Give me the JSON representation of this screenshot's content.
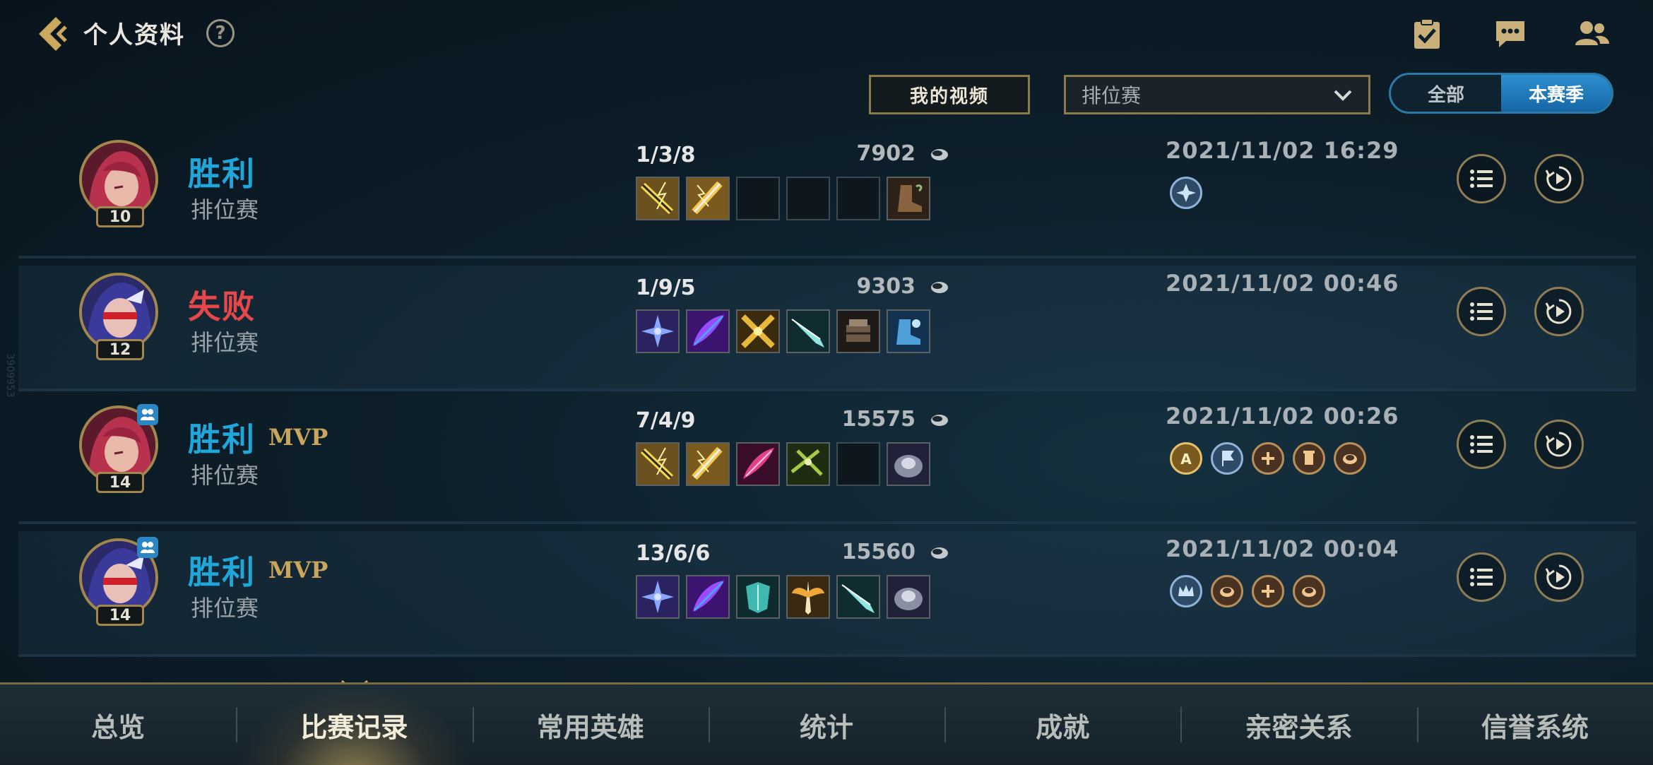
{
  "header": {
    "title": "个人资料",
    "help_glyph": "?",
    "icons": [
      "back-chevron-icon",
      "help-icon",
      "task-clipboard-icon",
      "chat-icon",
      "friends-icon"
    ]
  },
  "filters": {
    "video_label": "我的视频",
    "mode_selected": "排位赛",
    "season_options": [
      "全部",
      "本赛季"
    ],
    "season_active": "本赛季"
  },
  "matches": [
    {
      "result": "胜利",
      "outcome": "win",
      "mvp": "",
      "mode": "排位赛",
      "level": "10",
      "team": false,
      "kda": "1/3/8",
      "gold": "7902",
      "datetime": "2021/11/02 16:29",
      "items": [
        "golden-lightning-sword",
        "golden-lightning-blade",
        "",
        "",
        "",
        "leather-boots"
      ],
      "badges": [
        "triple-kill-badge"
      ]
    },
    {
      "result": "失败",
      "outcome": "lose",
      "mvp": "",
      "mode": "排位赛",
      "level": "12",
      "team": false,
      "kda": "1/9/5",
      "gold": "9303",
      "datetime": "2021/11/02 00:46",
      "items": [
        "purple-shuriken",
        "violet-feather-blade",
        "golden-cross-blades",
        "teal-dagger",
        "dark-gauntlet",
        "blue-arcane-boots"
      ],
      "badges": []
    },
    {
      "result": "胜利",
      "outcome": "win",
      "mvp": "MVP",
      "mode": "排位赛",
      "level": "14",
      "team": true,
      "kda": "7/4/9",
      "gold": "15575",
      "datetime": "2021/11/02 00:26",
      "items": [
        "golden-lightning-sword",
        "golden-lightning-blade",
        "crimson-feather-blade",
        "green-crossbow",
        "",
        "stone-armor"
      ],
      "badges": [
        "a-rank-badge",
        "flag-badge",
        "assist-badge",
        "tower-badge",
        "gold-badge"
      ]
    },
    {
      "result": "胜利",
      "outcome": "win",
      "mvp": "MVP",
      "mode": "排位赛",
      "level": "14",
      "team": true,
      "kda": "13/6/6",
      "gold": "15560",
      "datetime": "2021/11/02 00:04",
      "items": [
        "purple-shuriken",
        "violet-feather-blade",
        "teal-armor",
        "winged-angel-blade",
        "teal-dagger",
        "stone-armor"
      ],
      "badges": [
        "crown-badge",
        "gold-badge",
        "assist-badge",
        "gold-badge"
      ]
    }
  ],
  "nav": {
    "tabs": [
      "总览",
      "比赛记录",
      "常用英雄",
      "统计",
      "成就",
      "亲密关系",
      "信誉系统"
    ],
    "active": "比赛记录"
  },
  "colors": {
    "win": "#1ea7d8",
    "lose": "#e5474a",
    "mvp": "#c8a65b",
    "accent_blue": "#2d8fcf",
    "gold_border": "#8b7a4c"
  }
}
